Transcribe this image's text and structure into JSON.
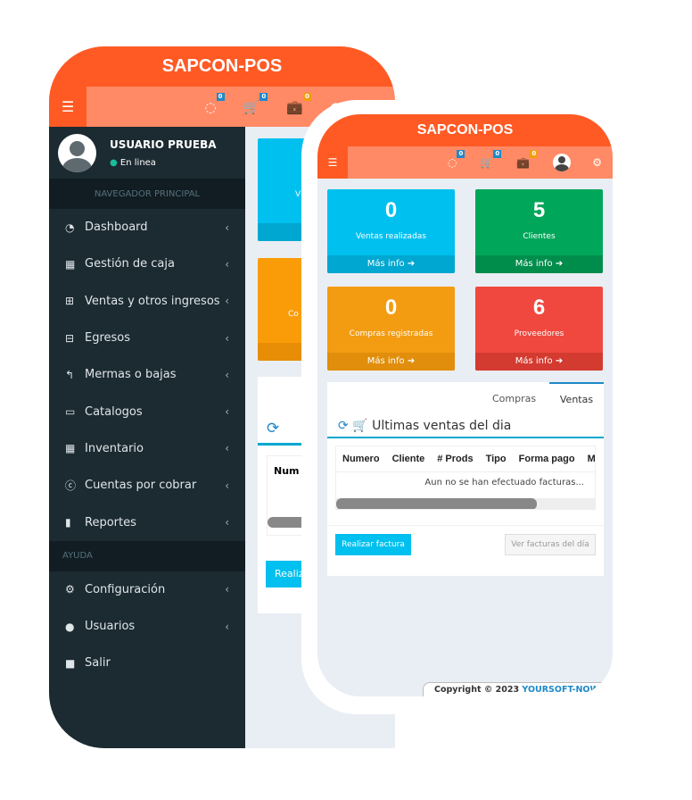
{
  "app": {
    "title": "SAPCON-POS"
  },
  "navbar": {
    "badges": [
      "0",
      "0",
      "0"
    ],
    "colors": {
      "blue": "#1e88c9",
      "orange": "#f39c12"
    }
  },
  "user": {
    "name": "USUARIO PRUEBA",
    "status": "En linea"
  },
  "sidebar": {
    "section_main": "NAVEGADOR PRINCIPAL",
    "items": [
      {
        "label": "Dashboard",
        "icon": "dashboard-icon"
      },
      {
        "label": "Gestión de caja",
        "icon": "grid-icon"
      },
      {
        "label": "Ventas y otros ingresos",
        "icon": "plus-square-icon"
      },
      {
        "label": "Egresos",
        "icon": "minus-square-icon"
      },
      {
        "label": "Mermas o bajas",
        "icon": "reply-icon"
      },
      {
        "label": "Catalogos",
        "icon": "calendar-icon"
      },
      {
        "label": "Inventario",
        "icon": "table-icon"
      },
      {
        "label": "Cuentas por cobrar",
        "icon": "cc-icon"
      },
      {
        "label": "Reportes",
        "icon": "bar-chart-icon"
      }
    ],
    "section_help": "AYUDA",
    "help_items": [
      {
        "label": "Configuración",
        "icon": "gears-icon"
      },
      {
        "label": "Usuarios",
        "icon": "user-icon"
      },
      {
        "label": "Salir",
        "icon": "lock-icon"
      }
    ]
  },
  "back_partial": {
    "card1": "V",
    "card2": "Co",
    "col": "Num",
    "btn": "Realiz"
  },
  "cards": [
    {
      "value": "0",
      "label": "Ventas realizadas",
      "more": "Más info",
      "color": "#00c0ef"
    },
    {
      "value": "5",
      "label": "Clientes",
      "more": "Más info",
      "color": "#00a65a"
    },
    {
      "value": "0",
      "label": "Compras registradas",
      "more": "Más info",
      "color": "#f39c12"
    },
    {
      "value": "6",
      "label": "Proveedores",
      "more": "Más info",
      "color": "#f0483e"
    }
  ],
  "panel": {
    "tabs": [
      "Compras",
      "Ventas"
    ],
    "active_tab": "Ventas",
    "title": "Ultimas ventas del dia",
    "columns": [
      "Numero",
      "Cliente",
      "# Prods",
      "Tipo",
      "Forma pago",
      "M"
    ],
    "empty": "Aun no se han efectuado facturas...",
    "primary_button": "Realizar factura",
    "secondary_button": "Ver facturas del día"
  },
  "footer": {
    "copyright": "Copyright © 2023",
    "brand": "YOURSOFT-NOW"
  }
}
